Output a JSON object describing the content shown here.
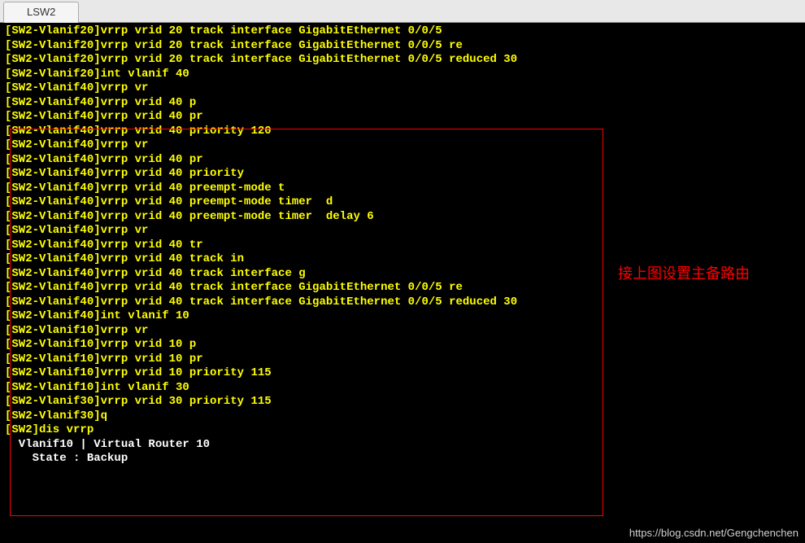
{
  "tabs": {
    "active": "LSW2"
  },
  "terminal": {
    "lines": [
      {
        "class": "yellow",
        "text": "[SW2-Vlanif20]vrrp vrid 20 track interface GigabitEthernet 0/0/5"
      },
      {
        "class": "yellow",
        "text": "[SW2-Vlanif20]vrrp vrid 20 track interface GigabitEthernet 0/0/5 re"
      },
      {
        "class": "yellow",
        "text": "[SW2-Vlanif20]vrrp vrid 20 track interface GigabitEthernet 0/0/5 reduced 30"
      },
      {
        "class": "yellow",
        "text": "[SW2-Vlanif20]int vlanif 40"
      },
      {
        "class": "yellow",
        "text": "[SW2-Vlanif40]vrrp vr"
      },
      {
        "class": "yellow",
        "text": "[SW2-Vlanif40]vrrp vrid 40 p"
      },
      {
        "class": "yellow",
        "text": "[SW2-Vlanif40]vrrp vrid 40 pr"
      },
      {
        "class": "yellow",
        "text": "[SW2-Vlanif40]vrrp vrid 40 priority 120"
      },
      {
        "class": "yellow",
        "text": "[SW2-Vlanif40]vrrp vr"
      },
      {
        "class": "yellow",
        "text": "[SW2-Vlanif40]vrrp vrid 40 pr"
      },
      {
        "class": "yellow",
        "text": "[SW2-Vlanif40]vrrp vrid 40 priority"
      },
      {
        "class": "yellow",
        "text": "[SW2-Vlanif40]vrrp vrid 40 preempt-mode t"
      },
      {
        "class": "yellow",
        "text": "[SW2-Vlanif40]vrrp vrid 40 preempt-mode timer  d"
      },
      {
        "class": "yellow",
        "text": "[SW2-Vlanif40]vrrp vrid 40 preempt-mode timer  delay 6"
      },
      {
        "class": "yellow",
        "text": "[SW2-Vlanif40]vrrp vr"
      },
      {
        "class": "yellow",
        "text": "[SW2-Vlanif40]vrrp vrid 40 tr"
      },
      {
        "class": "yellow",
        "text": "[SW2-Vlanif40]vrrp vrid 40 track in"
      },
      {
        "class": "yellow",
        "text": "[SW2-Vlanif40]vrrp vrid 40 track interface g"
      },
      {
        "class": "yellow",
        "text": "[SW2-Vlanif40]vrrp vrid 40 track interface GigabitEthernet 0/0/5 re"
      },
      {
        "class": "yellow",
        "text": "[SW2-Vlanif40]vrrp vrid 40 track interface GigabitEthernet 0/0/5 reduced 30"
      },
      {
        "class": "yellow",
        "text": "[SW2-Vlanif40]int vlanif 10"
      },
      {
        "class": "yellow",
        "text": "[SW2-Vlanif10]vrrp vr"
      },
      {
        "class": "yellow",
        "text": "[SW2-Vlanif10]vrrp vrid 10 p"
      },
      {
        "class": "yellow",
        "text": "[SW2-Vlanif10]vrrp vrid 10 pr"
      },
      {
        "class": "yellow",
        "text": "[SW2-Vlanif10]vrrp vrid 10 priority 115"
      },
      {
        "class": "yellow",
        "text": "[SW2-Vlanif10]int vlanif 30"
      },
      {
        "class": "yellow",
        "text": "[SW2-Vlanif30]vrrp vrid 30 priority 115"
      },
      {
        "class": "yellow",
        "text": "[SW2-Vlanif30]q"
      },
      {
        "class": "yellow",
        "text": "[SW2]dis vrrp"
      },
      {
        "class": "white",
        "text": "  Vlanif10 | Virtual Router 10"
      },
      {
        "class": "white",
        "text": "    State : Backup"
      }
    ]
  },
  "annotation": {
    "text": "接上图设置主备路由"
  },
  "watermark": "https://blog.csdn.net/Gengchenchen"
}
